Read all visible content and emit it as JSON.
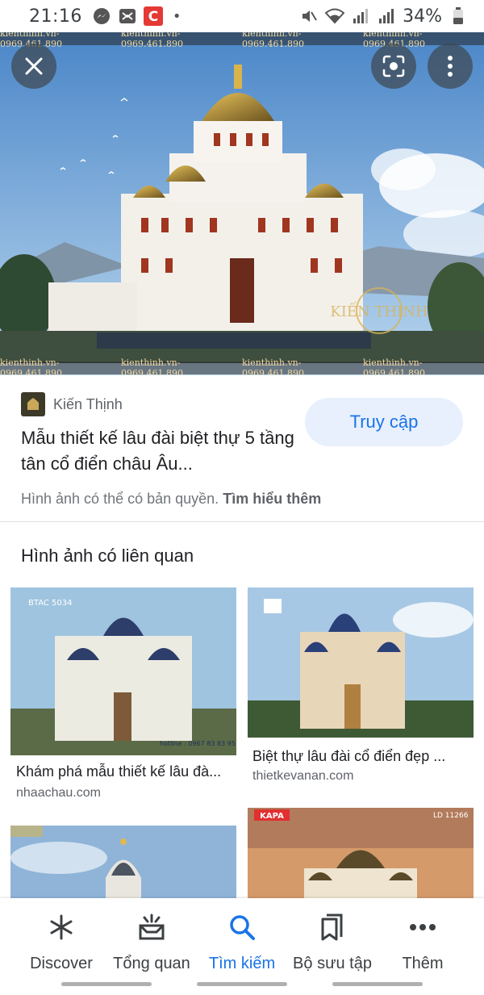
{
  "status_bar": {
    "time": "21:16",
    "battery_percent": "34%",
    "icons": [
      "messenger-icon",
      "gallery-icon",
      "app-c-icon",
      "mute-icon",
      "wifi-icon",
      "signal-icon",
      "signal-icon",
      "battery-icon"
    ]
  },
  "hero": {
    "watermark_text": "kienthinh.vn-0969.461.890",
    "logo_text": "KIẾN THỊNH"
  },
  "source": {
    "site_name": "Kiến Thịnh",
    "title": "Mẫu thiết kế lâu đài biệt thự 5 tầng tân cổ điển châu Âu...",
    "visit_label": "Truy cập",
    "copyright_text": "Hình ảnh có thể có bản quyền.",
    "learn_more": "Tìm hiểu thêm"
  },
  "related": {
    "heading": "Hình ảnh có liên quan",
    "items": [
      {
        "title": "Khám phá mẫu thiết kế lâu đà...",
        "site": "nhaachau.com",
        "thumb_code": "BTAC 5034",
        "thumb_hotline": "hotline : 0967 83 83 95"
      },
      {
        "title": "Biệt thự lâu đài cổ điển đẹp ...",
        "site": "thietkevanan.com"
      },
      {
        "title": "",
        "site": ""
      },
      {
        "title": "",
        "site": "",
        "thumb_code": "LD 11266",
        "thumb_brand": "KAPA"
      }
    ]
  },
  "bottom_nav": {
    "items": [
      {
        "label": "Discover",
        "icon": "asterisk-icon",
        "active": false
      },
      {
        "label": "Tổng quan",
        "icon": "updates-icon",
        "active": false
      },
      {
        "label": "Tìm kiếm",
        "icon": "search-icon",
        "active": true
      },
      {
        "label": "Bộ sưu tập",
        "icon": "collections-icon",
        "active": false
      },
      {
        "label": "Thêm",
        "icon": "more-horiz-icon",
        "active": false
      }
    ]
  },
  "colors": {
    "accent": "#1a73e8",
    "visit_button_bg": "#e8f0fe",
    "text_primary": "#202124",
    "text_secondary": "#5f6368"
  }
}
